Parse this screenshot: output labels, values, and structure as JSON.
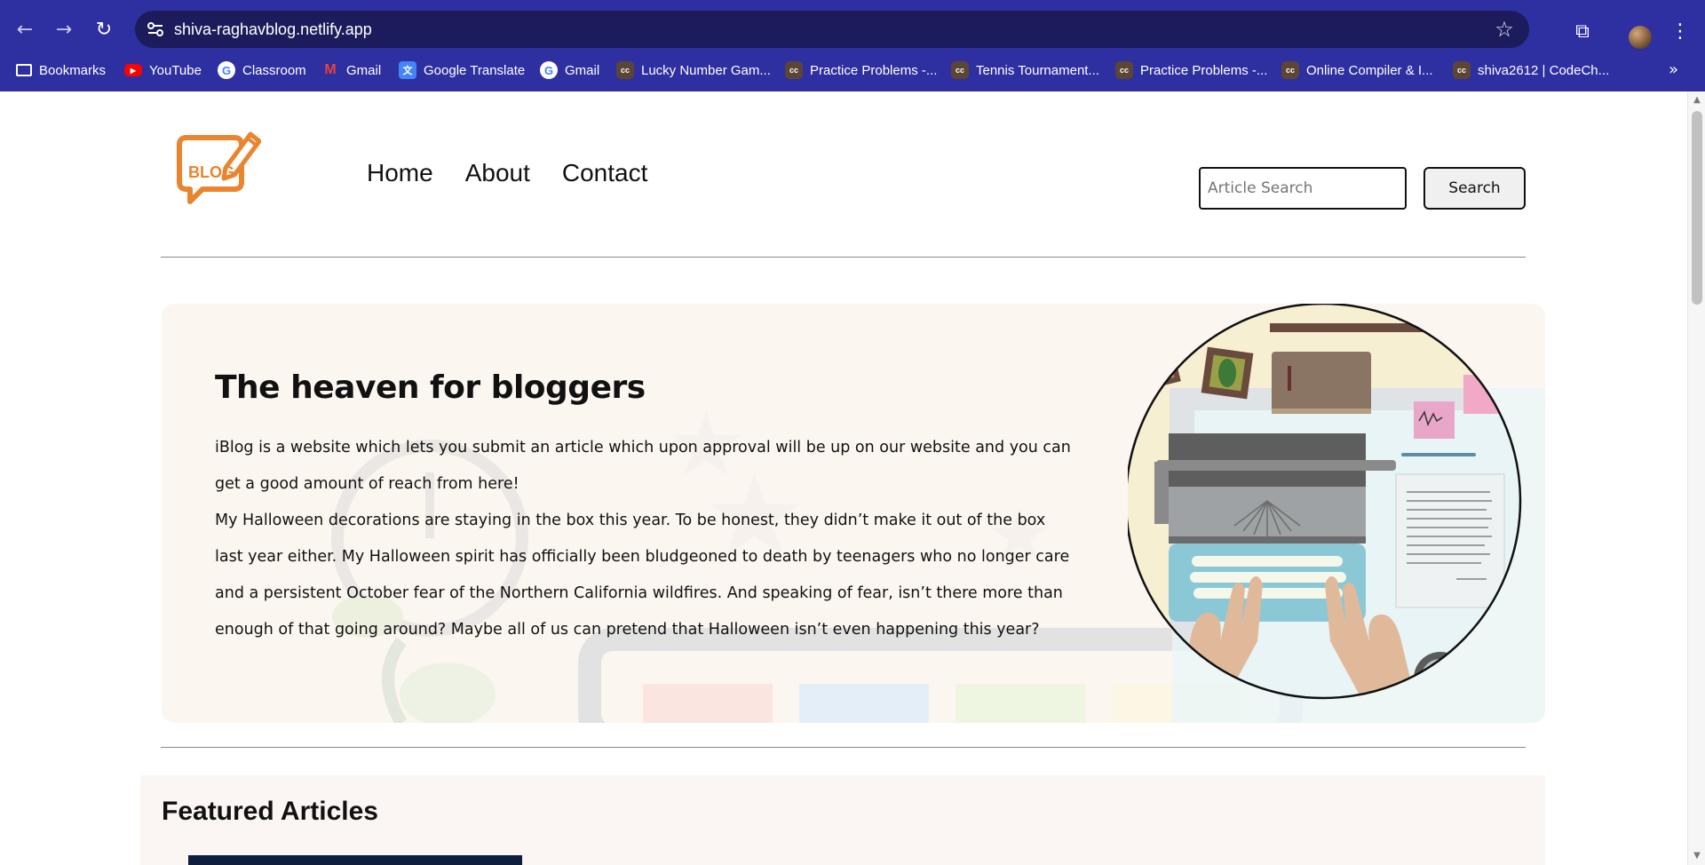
{
  "browser": {
    "url": "shiva-raghavblog.netlify.app",
    "bookmarks": [
      {
        "label": "Bookmarks",
        "icon": "folder-icon"
      },
      {
        "label": "YouTube",
        "icon": "youtube-icon"
      },
      {
        "label": "Classroom",
        "icon": "google-icon"
      },
      {
        "label": "Gmail",
        "icon": "gmail-icon"
      },
      {
        "label": "Google Translate",
        "icon": "google-translate-icon"
      },
      {
        "label": "Gmail",
        "icon": "google-icon"
      },
      {
        "label": "Lucky Number Gam...",
        "icon": "codechef-icon"
      },
      {
        "label": "Practice Problems -...",
        "icon": "codechef-icon"
      },
      {
        "label": "Tennis Tournament...",
        "icon": "codechef-icon"
      },
      {
        "label": "Practice Problems -...",
        "icon": "codechef-icon"
      },
      {
        "label": "Online Compiler & I...",
        "icon": "codechef-icon"
      },
      {
        "label": "shiva2612 | CodeCh...",
        "icon": "codechef-icon"
      }
    ]
  },
  "site": {
    "logo_text": "BLOG",
    "nav": [
      "Home",
      "About",
      "Contact"
    ],
    "search_placeholder": "Article Search",
    "search_button": "Search"
  },
  "hero": {
    "title": "The heaven for bloggers",
    "paragraph1": "iBlog is a website which lets you submit an article which upon approval will be up on our website and you can get a good amount of reach from here!",
    "paragraph2": "My Halloween decorations are staying in the box this year. To be honest, they didn’t make it out of the box last year either. My Halloween spirit has officially been bludgeoned to death by teenagers who no longer care and a persistent October fear of the Northern California wildfires. And speaking of fear, isn’t there more than enough of that going around? Maybe all of us can pretend that Halloween isn’t even happening this year?"
  },
  "featured": {
    "title": "Featured Articles"
  },
  "colors": {
    "chrome": "#2e2fa0",
    "omnibox": "#1c1c5c",
    "logo_orange": "#e8852e",
    "hero_bg": "#fcf6f0"
  }
}
